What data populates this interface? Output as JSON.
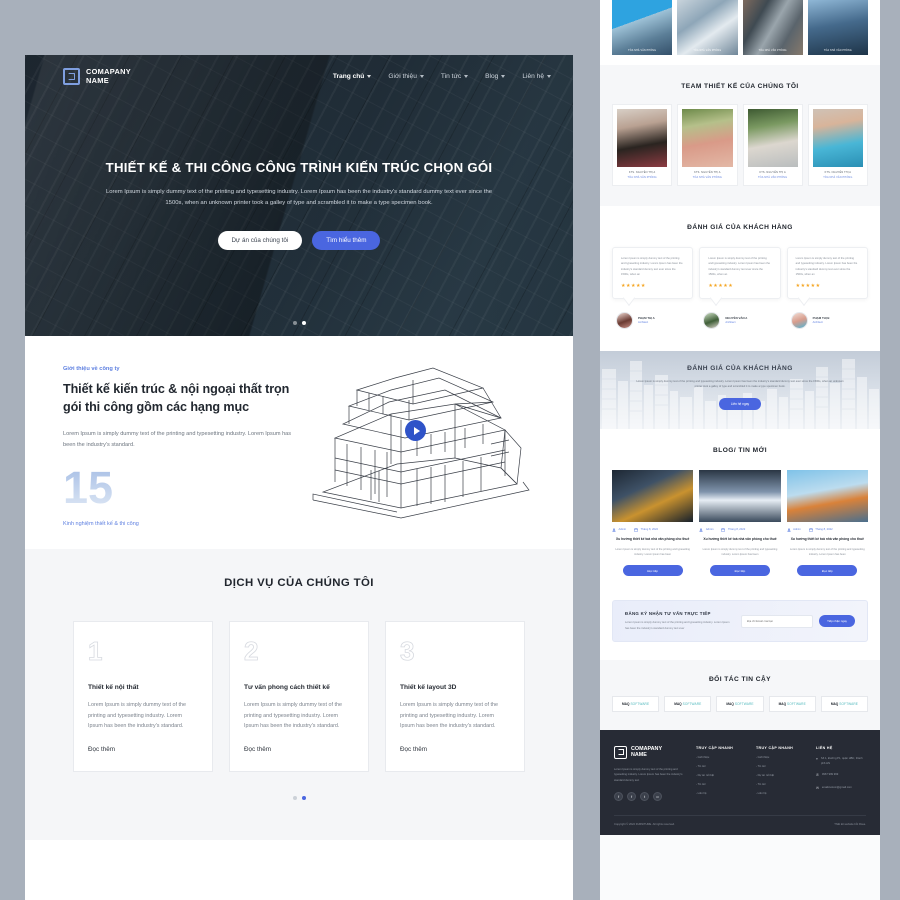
{
  "colors": {
    "accent": "#4a66e0",
    "link": "#5d7fe0",
    "star": "#f5a623",
    "footer_bg": "#272b35"
  },
  "header": {
    "brand_line1": "COMAPANY",
    "brand_line2": "NAME",
    "nav": [
      {
        "label": "Trang chủ",
        "active": true
      },
      {
        "label": "Giới thiệu",
        "active": false
      },
      {
        "label": "Tin tức",
        "active": false
      },
      {
        "label": "Blog",
        "active": false
      },
      {
        "label": "Liên hệ",
        "active": false
      }
    ]
  },
  "hero": {
    "title": "THIẾT KẾ & THI CÔNG CÔNG TRÌNH KIẾN TRÚC CHỌN GÓI",
    "subtitle": "Lorem Ipsum is simply dummy text of the printing and typesetting industry. Lorem Ipsum has been the industry's standard dummy text ever since the 1500s, when an unknown printer took a galley of type and scrambled it to make a type specimen book.",
    "btn_primary": "Dự án của chúng tôi",
    "btn_secondary": "Tìm hiểu thêm"
  },
  "intro": {
    "eyebrow": "Giới thiệu về công ty",
    "heading": "Thiết kế kiến trúc & nội ngoại thất trọn gói thi công gồm các hạng mục",
    "paragraph": "Lorem Ipsum is simply dummy text of the printing and typesetting industry. Lorem Ipsum has been the industry's standard.",
    "big_number": "15",
    "big_number_caption": "Kinh nghiệm thiết kế & thi công"
  },
  "services": {
    "title": "DỊCH VỤ CỦA CHÚNG TÔI",
    "cards": [
      {
        "num": "1",
        "title": "Thiết kế nội thất",
        "text": "Lorem Ipsum is simply dummy text of the printing and typesetting industry. Lorem Ipsum has been the industry's standard.",
        "more": "Đọc thêm"
      },
      {
        "num": "2",
        "title": "Tư vấn phong cách thiết kế",
        "text": "Lorem Ipsum is simply dummy text of the printing and typesetting industry. Lorem Ipsum has been the industry's standard.",
        "more": "Đọc thêm"
      },
      {
        "num": "3",
        "title": "Thiết kế layout 3D",
        "text": "Lorem Ipsum is simply dummy text of the printing and typesetting industry. Lorem Ipsum has been the industry's standard.",
        "more": "Đọc thêm"
      }
    ]
  },
  "projects": {
    "items": [
      {
        "caption": "TÒA NHÀ VĂN PHÒNG"
      },
      {
        "caption": "TÒA NHÀ VĂN PHÒNG"
      },
      {
        "caption": "TÒA NHÀ VĂN PHÒNG"
      },
      {
        "caption": "TÒA NHÀ VĂN PHÒNG"
      }
    ]
  },
  "team": {
    "title": "TEAM THIẾT KẾ CỦA CHÚNG TÔI",
    "members": [
      {
        "name": "KTS. NGUYỄN THỊ A",
        "role": "TÒA NHÀ VĂN PHÒNG"
      },
      {
        "name": "KTS. NGUYỄN THỊ A",
        "role": "TÒA NHÀ VĂN PHÒNG"
      },
      {
        "name": "KTS. NGUYỄN THỊ A",
        "role": "TÒA NHÀ VĂN PHÒNG"
      },
      {
        "name": "KTS. NGUYỄN THỊ A",
        "role": "TÒA NHÀ VĂN PHÒNG"
      }
    ]
  },
  "testimonials": {
    "title": "ĐÁNH GIÁ CỦA KHÁCH HÀNG",
    "items": [
      {
        "text": "Lorem Ipsum is simply dummy text of the printing and typesetting industry. Lorem Ipsum has been the industry's standard dummy text ever since the 1500s, when an",
        "stars": "★★★★★",
        "name": "PHẠM THỊ A",
        "role": "Architect"
      },
      {
        "text": "Lorem Ipsum is simply dummy text of the printing and typesetting industry. Lorem Ipsum has been the industry's standard dummy text ever since the 1500s, when an",
        "stars": "★★★★★",
        "name": "NGUYỄN VĂN A",
        "role": "Architect"
      },
      {
        "text": "Lorem Ipsum is simply dummy text of the printing and typesetting industry. Lorem Ipsum has been the industry's standard dummy text ever since the 1500s, when an",
        "stars": "★★★★★",
        "name": "PHẠM THỊ B",
        "role": "Architect"
      }
    ]
  },
  "cta": {
    "title": "ĐÁNH GIÁ CỦA KHÁCH HÀNG",
    "text": "Lorem Ipsum is simply dummy text of the printing and typesetting industry. Lorem Ipsum has been the industry's standard dummy text ever since the 1500s, when an unknown printer took a galley of type and scrambled it to make a type specimen book.",
    "button": "Liên hệ ngay"
  },
  "blog": {
    "title": "BLOG/ TIN MỚI",
    "posts": [
      {
        "author": "Admin",
        "date": "Tháng 8, 2022",
        "title": "Xu hướng thiết kế toà nhà văn phòng cho thuê",
        "text": "Lorem Ipsum is simply dummy text of the printing and typesetting industry. Lorem Ipsum has been",
        "button": "Đọc tiếp"
      },
      {
        "author": "Admin",
        "date": "Tháng 8, 2022",
        "title": "Xu hướng thiết kế toà nhà văn phòng cho thuê",
        "text": "Lorem Ipsum is simply dummy text of the printing and typesetting industry. Lorem Ipsum has been",
        "button": "Đọc tiếp"
      },
      {
        "author": "Admin",
        "date": "Tháng 8, 2022",
        "title": "Xu hướng thiết kế toà nhà văn phòng cho thuê",
        "text": "Lorem Ipsum is simply dummy text of the printing and typesetting industry. Lorem Ipsum has been",
        "button": "Đọc tiếp"
      }
    ]
  },
  "newsletter": {
    "title": "ĐĂNG KÝ NHẬN TƯ VẤN TRỰC TIẾP",
    "text": "Lorem Ipsum is simply dummy text of the printing and typesetting industry. Lorem Ipsum has been the industry's standard dummy text ever",
    "input_placeholder": "Địa chỉ Email của bạn",
    "input_value": "",
    "button": "Tiếp nhận ngay"
  },
  "partners": {
    "title": "ĐỐI TÁC TIN CẬY",
    "items": [
      {
        "mark": "MAQ",
        "soft": "SOFTWARE"
      },
      {
        "mark": "MAQ",
        "soft": "SOFTWARE"
      },
      {
        "mark": "MAQ",
        "soft": "SOFTWARE"
      },
      {
        "mark": "MAQ",
        "soft": "SOFTWARE"
      },
      {
        "mark": "MAQ",
        "soft": "SOFTWARE"
      }
    ]
  },
  "footer": {
    "brand_line1": "COMAPANY",
    "brand_line2": "NAME",
    "about": "Lorem Ipsum is simply dummy text of the printing and typesetting industry. Lorem Ipsum has been the industry's standard dummy text",
    "socials": [
      "f",
      "f",
      "t",
      "o"
    ],
    "col1_title": "TRUY CẬP NHANH",
    "col1_links": [
      "- Giới thiệu",
      "- Tin tức",
      "- Dự án nổi bật",
      "- Tin tức",
      "- Liên hệ"
    ],
    "col2_title": "TRUY CẬP NHANH",
    "col2_links": [
      "- Giới thiệu",
      "- Tin tức",
      "- Dự án nổi bật",
      "- Tin tức",
      "- Liên hệ"
    ],
    "contact_title": "LIÊN HỆ",
    "address": "Số 1, Đường P1, quận HBC, thành phố HN",
    "phone": "0967 999 999",
    "email": "emailcustom@gmail.com",
    "copyright": "Copyright © 2022 FURNITURE. All rights reserved.",
    "credit": "Thiết kế website bởi Rose."
  }
}
